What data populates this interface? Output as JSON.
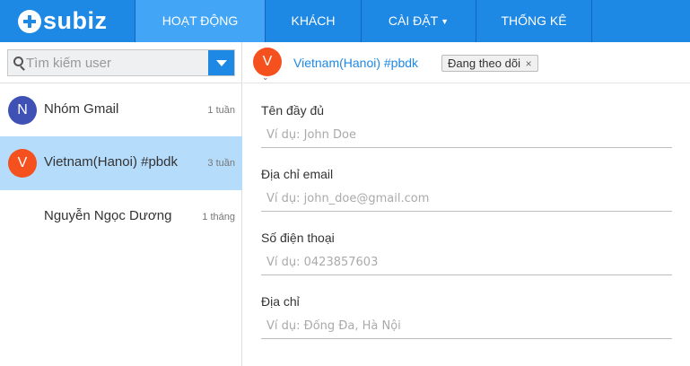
{
  "brand": {
    "name": "subiz"
  },
  "nav": {
    "tabs": [
      {
        "label": "HOẠT ĐỘNG",
        "active": true
      },
      {
        "label": "KHÁCH",
        "active": false
      },
      {
        "label": "CÀI ĐẶT",
        "active": false,
        "has_dropdown": true
      },
      {
        "label": "THỐNG KÊ",
        "active": false
      }
    ]
  },
  "search": {
    "placeholder": "Tìm kiếm user",
    "value": ""
  },
  "conversations": [
    {
      "initial": "N",
      "name": "Nhóm Gmail",
      "time": "1 tuần",
      "avatar_color": "#3f51b5",
      "selected": false
    },
    {
      "initial": "V",
      "name": "Vietnam(Hanoi) #pbdk",
      "time": "3 tuần",
      "avatar_color": "#f4511e",
      "selected": true
    },
    {
      "initial": "",
      "name": "Nguyễn Ngọc Dương",
      "time": "1 tháng",
      "avatar_color": "",
      "selected": false
    }
  ],
  "contact": {
    "initial": "V",
    "name": "Vietnam(Hanoi) #pbdk",
    "tag": "Đang theo dõi",
    "tag_close": "×"
  },
  "form": {
    "fields": [
      {
        "label": "Tên đầy đủ",
        "placeholder": "Ví dụ: John Doe",
        "value": ""
      },
      {
        "label": "Địa chỉ email",
        "placeholder": "Ví dụ: john_doe@gmail.com",
        "value": ""
      },
      {
        "label": "Số điện thoại",
        "placeholder": "Ví dụ: 0423857603",
        "value": ""
      },
      {
        "label": "Địa chỉ",
        "placeholder": "Ví dụ: Đống Đa, Hà Nội",
        "value": ""
      }
    ]
  },
  "colors": {
    "primary": "#1e88e5",
    "active_tab": "#42a5f5",
    "selected_row": "#b6dcfb"
  }
}
